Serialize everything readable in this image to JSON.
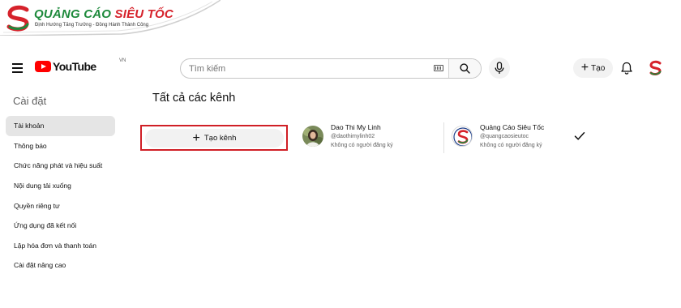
{
  "watermark": {
    "brand_prefix": "QUẢNG CÁO",
    "brand_highlight": "SIÊU TỐC",
    "tagline": "Định Hướng Tăng Trưởng - Đồng Hành Thành Công",
    "colors": {
      "green": "#1e8a3c",
      "red": "#d6222b"
    }
  },
  "header": {
    "logo_text": "YouTube",
    "logo_region": "VN",
    "search": {
      "placeholder": "Tìm kiếm",
      "value": ""
    },
    "create_label": "Tạo",
    "icons": [
      "menu-icon",
      "keyboard-icon",
      "search-icon",
      "mic-icon",
      "plus-icon",
      "bell-icon"
    ]
  },
  "sidebar": {
    "title": "Cài đặt",
    "items": [
      {
        "label": "Tài khoản",
        "active": true
      },
      {
        "label": "Thông báo",
        "active": false
      },
      {
        "label": "Chức năng phát và hiệu suất",
        "active": false
      },
      {
        "label": "Nội dung tải xuống",
        "active": false
      },
      {
        "label": "Quyền riêng tư",
        "active": false
      },
      {
        "label": "Ứng dụng đã kết nối",
        "active": false
      },
      {
        "label": "Lập hóa đơn và thanh toán",
        "active": false
      },
      {
        "label": "Cài đặt nâng cao",
        "active": false
      }
    ]
  },
  "main": {
    "title": "Tất cả các kênh",
    "create_channel_label": "Tạo kênh",
    "channels": [
      {
        "name": "Dao Thi My Linh",
        "handle": "@daothimylinh02",
        "subscribers": "Không có người đăng ký",
        "selected": false
      },
      {
        "name": "Quảng Cáo Siêu Tốc",
        "handle": "@quangcaosieutoc",
        "subscribers": "Không có người đăng ký",
        "selected": true
      }
    ]
  },
  "colors": {
    "highlight_border": "#d01f26",
    "youtube_red": "#ff0000",
    "active_bg": "#e5e5e5"
  }
}
